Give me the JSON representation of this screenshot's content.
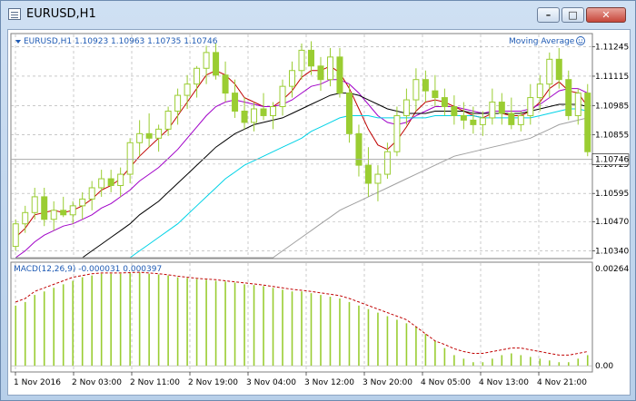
{
  "window": {
    "title": "EURUSD,H1",
    "buttons": {
      "minimize": "–",
      "maximize": "□",
      "close": "✕"
    }
  },
  "price_panel": {
    "info": "EURUSD,H1  1.10923 1.10963 1.10735 1.10746",
    "indicator_label": "Moving Average",
    "current_price": "1.10746",
    "y_labels": [
      "1.11245",
      "1.11115",
      "1.10985",
      "1.10855",
      "1.10725",
      "1.10595",
      "1.10470",
      "1.10340"
    ]
  },
  "macd_panel": {
    "info": "MACD(12,26,9) -0.000031 0.000397",
    "y_labels": [
      "0.002643",
      "0.00"
    ]
  },
  "x_labels": [
    "1 Nov 2016",
    "2 Nov 03:00",
    "2 Nov 11:00",
    "2 Nov 19:00",
    "3 Nov 04:00",
    "3 Nov 12:00",
    "3 Nov 20:00",
    "4 Nov 05:00",
    "4 Nov 13:00",
    "4 Nov 21:00"
  ],
  "colors": {
    "bull": "#9acd32",
    "bear": "#9acd32",
    "grid": "#a9a9a9",
    "ma_fast": "#c00000",
    "ma_2": "#a000c8",
    "ma_3": "#000000",
    "ma_4": "#00d2e6",
    "ma_5": "#a0a0a0",
    "macd_signal": "#c00000",
    "text": "#1e5ab4"
  },
  "chart_data": {
    "type": "candlestick",
    "symbol": "EURUSD",
    "timeframe": "H1",
    "price_ylim": [
      1.1031,
      1.113
    ],
    "ohlc": [
      [
        1.1036,
        1.1048,
        1.1034,
        1.1046
      ],
      [
        1.1046,
        1.1054,
        1.1042,
        1.1051
      ],
      [
        1.1051,
        1.1062,
        1.1048,
        1.1058
      ],
      [
        1.1058,
        1.1062,
        1.1045,
        1.1048
      ],
      [
        1.1048,
        1.1056,
        1.1043,
        1.1052
      ],
      [
        1.1052,
        1.1058,
        1.1049,
        1.105
      ],
      [
        1.105,
        1.1056,
        1.1046,
        1.1054
      ],
      [
        1.1054,
        1.106,
        1.1048,
        1.1057
      ],
      [
        1.1057,
        1.1065,
        1.1052,
        1.1062
      ],
      [
        1.1062,
        1.107,
        1.1058,
        1.1066
      ],
      [
        1.1066,
        1.107,
        1.106,
        1.1063
      ],
      [
        1.1063,
        1.1071,
        1.1058,
        1.1068
      ],
      [
        1.1068,
        1.1084,
        1.1064,
        1.1082
      ],
      [
        1.1082,
        1.1092,
        1.1076,
        1.1086
      ],
      [
        1.1086,
        1.1095,
        1.108,
        1.1084
      ],
      [
        1.1084,
        1.109,
        1.1078,
        1.1088
      ],
      [
        1.1088,
        1.1098,
        1.1085,
        1.1096
      ],
      [
        1.1096,
        1.1106,
        1.109,
        1.1103
      ],
      [
        1.1103,
        1.1112,
        1.1097,
        1.1108
      ],
      [
        1.1108,
        1.1116,
        1.1102,
        1.1115
      ],
      [
        1.1115,
        1.1125,
        1.1108,
        1.1122
      ],
      [
        1.1122,
        1.1126,
        1.111,
        1.1112
      ],
      [
        1.1112,
        1.1118,
        1.11,
        1.1104
      ],
      [
        1.1104,
        1.111,
        1.1093,
        1.1096
      ],
      [
        1.1096,
        1.1102,
        1.1088,
        1.1091
      ],
      [
        1.1091,
        1.11,
        1.1087,
        1.1097
      ],
      [
        1.1097,
        1.1104,
        1.1092,
        1.1094
      ],
      [
        1.1094,
        1.11,
        1.1088,
        1.1098
      ],
      [
        1.1098,
        1.111,
        1.1094,
        1.1107
      ],
      [
        1.1107,
        1.1118,
        1.1102,
        1.1114
      ],
      [
        1.1114,
        1.1126,
        1.111,
        1.1123
      ],
      [
        1.1123,
        1.1127,
        1.1112,
        1.1116
      ],
      [
        1.1116,
        1.112,
        1.1105,
        1.111
      ],
      [
        1.111,
        1.1124,
        1.1107,
        1.112
      ],
      [
        1.112,
        1.1124,
        1.1102,
        1.1104
      ],
      [
        1.1104,
        1.1108,
        1.1082,
        1.1086
      ],
      [
        1.1086,
        1.109,
        1.1067,
        1.1072
      ],
      [
        1.1072,
        1.108,
        1.1058,
        1.1064
      ],
      [
        1.1064,
        1.1072,
        1.1056,
        1.1068
      ],
      [
        1.1068,
        1.1082,
        1.1066,
        1.1078
      ],
      [
        1.1078,
        1.1098,
        1.1076,
        1.1094
      ],
      [
        1.1094,
        1.1106,
        1.109,
        1.1101
      ],
      [
        1.1101,
        1.1115,
        1.1096,
        1.111
      ],
      [
        1.111,
        1.1114,
        1.11,
        1.1105
      ],
      [
        1.1105,
        1.1112,
        1.1098,
        1.1102
      ],
      [
        1.1102,
        1.1106,
        1.1094,
        1.1098
      ],
      [
        1.1098,
        1.1103,
        1.109,
        1.1094
      ],
      [
        1.1094,
        1.11,
        1.1088,
        1.1092
      ],
      [
        1.1092,
        1.1098,
        1.1086,
        1.109
      ],
      [
        1.109,
        1.1096,
        1.1085,
        1.1093
      ],
      [
        1.1093,
        1.1106,
        1.109,
        1.11
      ],
      [
        1.11,
        1.1104,
        1.109,
        1.1095
      ],
      [
        1.1095,
        1.1102,
        1.1088,
        1.109
      ],
      [
        1.109,
        1.1096,
        1.1087,
        1.1094
      ],
      [
        1.1094,
        1.1108,
        1.109,
        1.1102
      ],
      [
        1.1102,
        1.1112,
        1.1096,
        1.1108
      ],
      [
        1.1108,
        1.1122,
        1.1102,
        1.1119
      ],
      [
        1.1119,
        1.1124,
        1.1106,
        1.111
      ],
      [
        1.111,
        1.1114,
        1.1092,
        1.1094
      ],
      [
        1.1094,
        1.1106,
        1.109,
        1.1104
      ],
      [
        1.1104,
        1.1108,
        1.1076,
        1.1078
      ]
    ],
    "ma_series": [
      {
        "values": [
          1.104,
          1.1044,
          1.105,
          1.1051,
          1.1052,
          1.1051,
          1.1052,
          1.1054,
          1.1057,
          1.1061,
          1.1063,
          1.1066,
          1.1071,
          1.1076,
          1.108,
          1.1084,
          1.1088,
          1.1094,
          1.11,
          1.1106,
          1.1112,
          1.1114,
          1.1112,
          1.1108,
          1.1102,
          1.11,
          1.1098,
          1.1098,
          1.1101,
          1.1105,
          1.1111,
          1.1114,
          1.1114,
          1.1116,
          1.1113,
          1.1106,
          1.1097,
          1.1088,
          1.1081,
          1.1079,
          1.1083,
          1.1089,
          1.1096,
          1.11,
          1.1101,
          1.11,
          1.1098,
          1.1096,
          1.1094,
          1.1093,
          1.1095,
          1.1095,
          1.1094,
          1.1094,
          1.1096,
          1.11,
          1.1106,
          1.1109,
          1.1105,
          1.1104,
          1.1098
        ]
      },
      {
        "values": [
          1.103,
          1.1034,
          1.1038,
          1.1041,
          1.1043,
          1.1045,
          1.1046,
          1.1048,
          1.105,
          1.1053,
          1.1055,
          1.1058,
          1.1061,
          1.1065,
          1.1068,
          1.1071,
          1.1075,
          1.1079,
          1.1084,
          1.1089,
          1.1094,
          1.1098,
          1.11,
          1.1101,
          1.11,
          1.1099,
          1.1098,
          1.1098,
          1.1099,
          1.1101,
          1.1104,
          1.1107,
          1.1108,
          1.111,
          1.111,
          1.1108,
          1.1104,
          1.1099,
          1.1094,
          1.1091,
          1.109,
          1.1091,
          1.1094,
          1.1096,
          1.1098,
          1.1098,
          1.1098,
          1.1097,
          1.1096,
          1.1095,
          1.1096,
          1.1096,
          1.1096,
          1.1096,
          1.1097,
          1.1099,
          1.1102,
          1.1105,
          1.1106,
          1.1106,
          1.1104
        ]
      },
      {
        "values": [
          1.101,
          1.1013,
          1.1016,
          1.1019,
          1.1022,
          1.1025,
          1.1028,
          1.1031,
          1.1034,
          1.1037,
          1.104,
          1.1043,
          1.1046,
          1.105,
          1.1053,
          1.1056,
          1.106,
          1.1064,
          1.1068,
          1.1072,
          1.1076,
          1.108,
          1.1083,
          1.1086,
          1.1088,
          1.109,
          1.1091,
          1.1092,
          1.1093,
          1.1095,
          1.1097,
          1.1099,
          1.1101,
          1.1103,
          1.1104,
          1.1104,
          1.1103,
          1.1101,
          1.1099,
          1.1097,
          1.1096,
          1.1095,
          1.1095,
          1.1095,
          1.1096,
          1.1096,
          1.1096,
          1.1096,
          1.1095,
          1.1095,
          1.1095,
          1.1095,
          1.1095,
          1.1095,
          1.1096,
          1.1097,
          1.1098,
          1.1099,
          1.1099,
          1.1099,
          1.1098
        ]
      },
      {
        "values": [
          1.099,
          1.0994,
          1.0998,
          1.1002,
          1.1006,
          1.101,
          1.1013,
          1.1016,
          1.1019,
          1.1022,
          1.1025,
          1.1028,
          1.1031,
          1.1034,
          1.1037,
          1.104,
          1.1043,
          1.1046,
          1.105,
          1.1054,
          1.1058,
          1.1062,
          1.1066,
          1.1069,
          1.1072,
          1.1074,
          1.1076,
          1.1078,
          1.108,
          1.1082,
          1.1084,
          1.1087,
          1.1089,
          1.1091,
          1.1093,
          1.1094,
          1.1094,
          1.1094,
          1.1093,
          1.1093,
          1.1093,
          1.1093,
          1.1093,
          1.1093,
          1.1094,
          1.1094,
          1.1094,
          1.1094,
          1.1094,
          1.1093,
          1.1093,
          1.1093,
          1.1093,
          1.1093,
          1.1093,
          1.1094,
          1.1095,
          1.1096,
          1.1097,
          1.1097,
          1.1096
        ]
      },
      {
        "values": [
          1.095,
          1.0953,
          1.0956,
          1.0959,
          1.0962,
          1.0965,
          1.0968,
          1.0971,
          1.0974,
          1.0977,
          1.098,
          1.0983,
          1.0986,
          1.0989,
          1.0992,
          1.0995,
          1.0998,
          1.1001,
          1.1004,
          1.1007,
          1.101,
          1.1013,
          1.1016,
          1.1019,
          1.1022,
          1.1025,
          1.1028,
          1.1031,
          1.1034,
          1.1037,
          1.104,
          1.1043,
          1.1046,
          1.1049,
          1.1052,
          1.1054,
          1.1056,
          1.1058,
          1.106,
          1.1062,
          1.1064,
          1.1066,
          1.1068,
          1.107,
          1.1072,
          1.1074,
          1.1076,
          1.1077,
          1.1078,
          1.1079,
          1.108,
          1.1081,
          1.1082,
          1.1083,
          1.1084,
          1.1086,
          1.1088,
          1.109,
          1.1091,
          1.1092,
          1.1093
        ]
      }
    ],
    "macd_ylim": [
      -0.00015,
      0.0029
    ],
    "macd_hist": [
      0.0017,
      0.0018,
      0.002,
      0.0021,
      0.0022,
      0.0023,
      0.0024,
      0.0025,
      0.00255,
      0.0026,
      0.0026,
      0.0026,
      0.00262,
      0.00264,
      0.0026,
      0.00258,
      0.00255,
      0.0025,
      0.00248,
      0.00245,
      0.00243,
      0.0024,
      0.00238,
      0.00235,
      0.0023,
      0.00228,
      0.00225,
      0.0022,
      0.00215,
      0.0021,
      0.0021,
      0.00205,
      0.002,
      0.00195,
      0.0019,
      0.0018,
      0.0017,
      0.0016,
      0.0015,
      0.0014,
      0.0013,
      0.0012,
      0.0011,
      0.0009,
      0.0007,
      0.0005,
      0.0003,
      0.0002,
      0.0001,
      0.0001,
      0.0002,
      0.0003,
      0.00035,
      0.0003,
      0.00025,
      0.0002,
      0.00015,
      0.0001,
      0.0001,
      0.0002,
      0.0003
    ],
    "macd_signal": [
      0.0018,
      0.0019,
      0.0021,
      0.0022,
      0.0023,
      0.0024,
      0.0025,
      0.00255,
      0.0026,
      0.00262,
      0.00262,
      0.00262,
      0.00263,
      0.00264,
      0.00262,
      0.0026,
      0.00257,
      0.00253,
      0.0025,
      0.00247,
      0.00245,
      0.00243,
      0.0024,
      0.00237,
      0.00234,
      0.00231,
      0.00228,
      0.00224,
      0.0022,
      0.00216,
      0.00213,
      0.0021,
      0.00206,
      0.00202,
      0.00198,
      0.0019,
      0.0018,
      0.0017,
      0.0016,
      0.0015,
      0.0014,
      0.0013,
      0.0011,
      0.0009,
      0.0007,
      0.0006,
      0.00048,
      0.0004,
      0.00035,
      0.00035,
      0.0004,
      0.00045,
      0.0005,
      0.0005,
      0.00045,
      0.0004,
      0.00035,
      0.0003,
      0.0003,
      0.00035,
      0.0004
    ]
  }
}
